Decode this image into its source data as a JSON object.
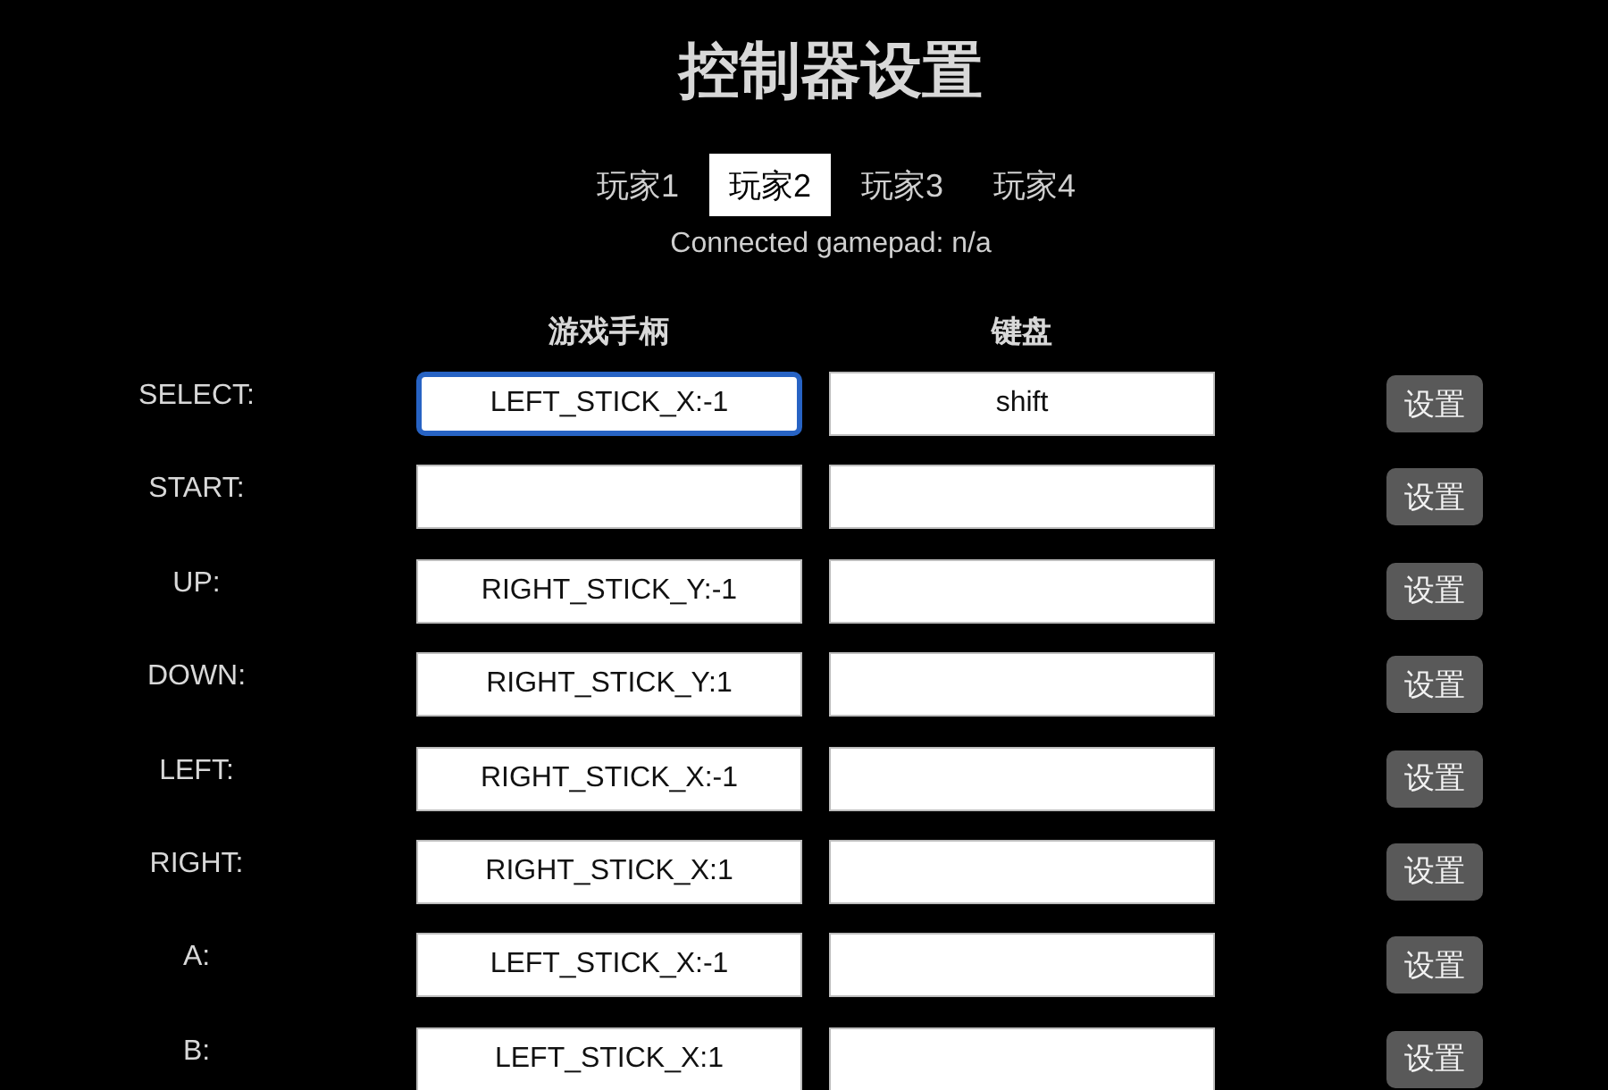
{
  "title": "控制器设置",
  "tabs": [
    {
      "label": "玩家1",
      "selected": false
    },
    {
      "label": "玩家2",
      "selected": true
    },
    {
      "label": "玩家3",
      "selected": false
    },
    {
      "label": "玩家4",
      "selected": false
    }
  ],
  "status": "Connected gamepad: n/a",
  "columns": [
    "游戏手柄",
    "键盘"
  ],
  "rows": [
    {
      "action": "SELECT:",
      "gamepad": {
        "value": "LEFT_STICK_X:-1",
        "focused": true
      },
      "keyboard": {
        "value": "shift",
        "focused": false
      },
      "button": "设置"
    },
    {
      "action": "START:",
      "gamepad": {
        "focused": false
      },
      "keyboard": {
        "focused": false
      },
      "button": "设置"
    },
    {
      "action": "UP:",
      "gamepad": {
        "value": "RIGHT_STICK_Y:-1",
        "focused": false
      },
      "keyboard": {
        "focused": false
      },
      "button": "设置"
    },
    {
      "action": "DOWN:",
      "gamepad": {
        "value": "RIGHT_STICK_Y:1",
        "focused": false
      },
      "keyboard": {
        "focused": false
      },
      "button": "设置"
    },
    {
      "action": "LEFT:",
      "gamepad": {
        "value": "RIGHT_STICK_X:-1",
        "focused": false
      },
      "keyboard": {
        "focused": false
      },
      "button": "设置"
    },
    {
      "action": "RIGHT:",
      "gamepad": {
        "value": "RIGHT_STICK_X:1",
        "focused": false
      },
      "keyboard": {
        "focused": false
      },
      "button": "设置"
    },
    {
      "action": "A:",
      "gamepad": {
        "value": "LEFT_STICK_X:-1",
        "focused": false
      },
      "keyboard": {
        "focused": false
      },
      "button": "设置"
    },
    {
      "action": "B:",
      "gamepad": {
        "value": "LEFT_STICK_X:1",
        "focused": false
      },
      "keyboard": {
        "focused": false
      },
      "button": "设置"
    }
  ]
}
